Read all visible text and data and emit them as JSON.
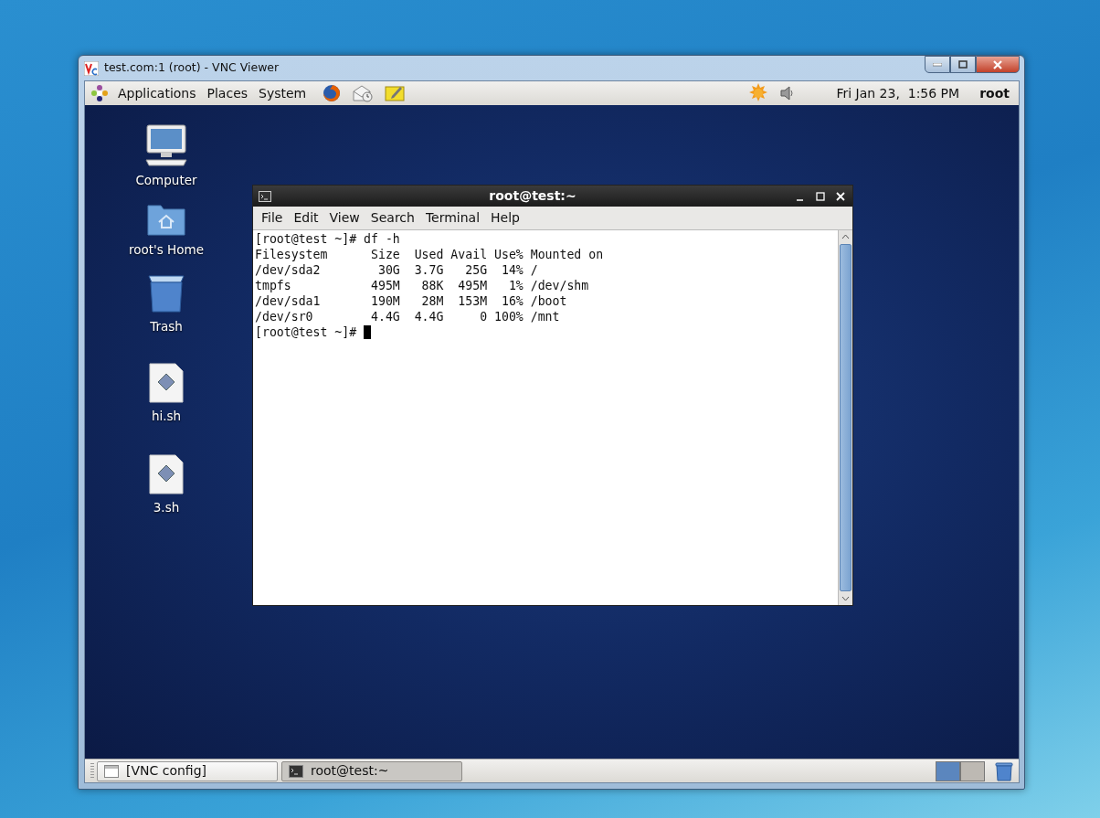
{
  "vnc_window": {
    "title": "test.com:1 (root) - VNC Viewer"
  },
  "top_panel": {
    "menus": [
      "Applications",
      "Places",
      "System"
    ],
    "clock": "Fri Jan 23,  1:56 PM",
    "user": "root"
  },
  "desktop_icons": [
    {
      "label": "Computer",
      "kind": "computer"
    },
    {
      "label": "root's Home",
      "kind": "home"
    },
    {
      "label": "Trash",
      "kind": "trash"
    },
    {
      "label": "hi.sh",
      "kind": "script"
    },
    {
      "label": "3.sh",
      "kind": "script"
    }
  ],
  "terminal": {
    "title": "root@test:~",
    "menus": [
      "File",
      "Edit",
      "View",
      "Search",
      "Terminal",
      "Help"
    ],
    "lines": [
      "[root@test ~]# df -h",
      "Filesystem      Size  Used Avail Use% Mounted on",
      "/dev/sda2        30G  3.7G   25G  14% /",
      "tmpfs           495M   88K  495M   1% /dev/shm",
      "/dev/sda1       190M   28M  153M  16% /boot",
      "/dev/sr0        4.4G  4.4G     0 100% /mnt",
      "[root@test ~]# "
    ],
    "cursor_visible": true
  },
  "taskbar": {
    "tasks": [
      {
        "label": "[VNC config]",
        "kind": "window",
        "selected": false
      },
      {
        "label": "root@test:~",
        "kind": "terminal",
        "selected": true
      }
    ],
    "workspaces": [
      {
        "selected": true
      },
      {
        "selected": false
      }
    ]
  }
}
